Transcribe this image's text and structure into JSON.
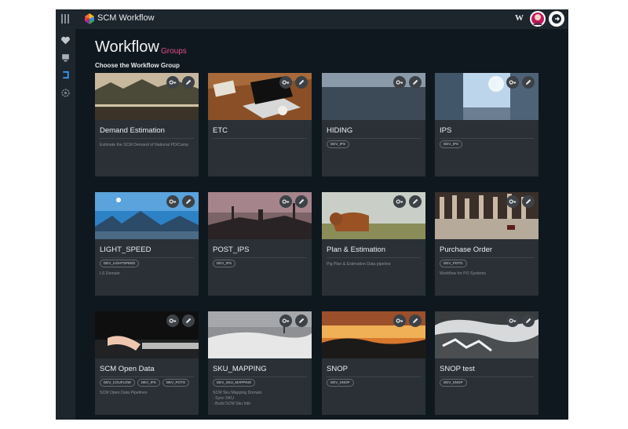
{
  "app": {
    "title": "SCM Workflow",
    "w_label": "W"
  },
  "sidebar": {
    "items": [
      {
        "icon": "heart-icon"
      },
      {
        "icon": "monitor-icon"
      },
      {
        "icon": "bracket-icon"
      },
      {
        "icon": "gear-icon"
      }
    ]
  },
  "page": {
    "title": "Workflow",
    "subtitle": "Groups",
    "section_label": "Choose the Workflow Group"
  },
  "cards": [
    {
      "title": "Demand Estimation",
      "tags": [],
      "desc": [
        "Estimate the SCM Demand of National PD/Camp"
      ]
    },
    {
      "title": "ETC",
      "tags": [],
      "desc": []
    },
    {
      "title": "HIDING",
      "tags": [
        "DEV_IPS"
      ],
      "desc": []
    },
    {
      "title": "IPS",
      "tags": [
        "DEV_IPS"
      ],
      "desc": []
    },
    {
      "title": "LIGHT_SPEED",
      "tags": [
        "DEV_LIGHTSPEED"
      ],
      "desc": [
        "LS Domain"
      ]
    },
    {
      "title": "POST_IPS",
      "tags": [
        "DEV_IPS"
      ],
      "desc": []
    },
    {
      "title": "Plan & Estimation",
      "tags": [],
      "desc": [
        "Pig Plan & Estimation Data pipeline"
      ]
    },
    {
      "title": "Purchase Order",
      "tags": [
        "DEV_POTG"
      ],
      "desc": [
        "Workflow for PO Systems"
      ]
    },
    {
      "title": "SCM Open Data",
      "tags": [
        "DEV_COUFLOW",
        "DEV_IPS",
        "DEV_POTG"
      ],
      "desc": [
        "SCM Open Data Pipelines"
      ]
    },
    {
      "title": "SKU_MAPPING",
      "tags": [
        "DEV_SKU_MAPPING"
      ],
      "desc": [
        "SCM Sku Mapping Domain",
        "- Sync SKU",
        "- Build SCM Sku Info"
      ]
    },
    {
      "title": "SNOP",
      "tags": [
        "DEV_SNOP"
      ],
      "desc": []
    },
    {
      "title": "SNOP test",
      "tags": [
        "DEV_SNOP"
      ],
      "desc": []
    }
  ],
  "colors": {
    "background": "#10181f",
    "bar": "#1d252d",
    "card": "#2a3036",
    "accent": "#e14b8f",
    "text": "#eceef0"
  }
}
